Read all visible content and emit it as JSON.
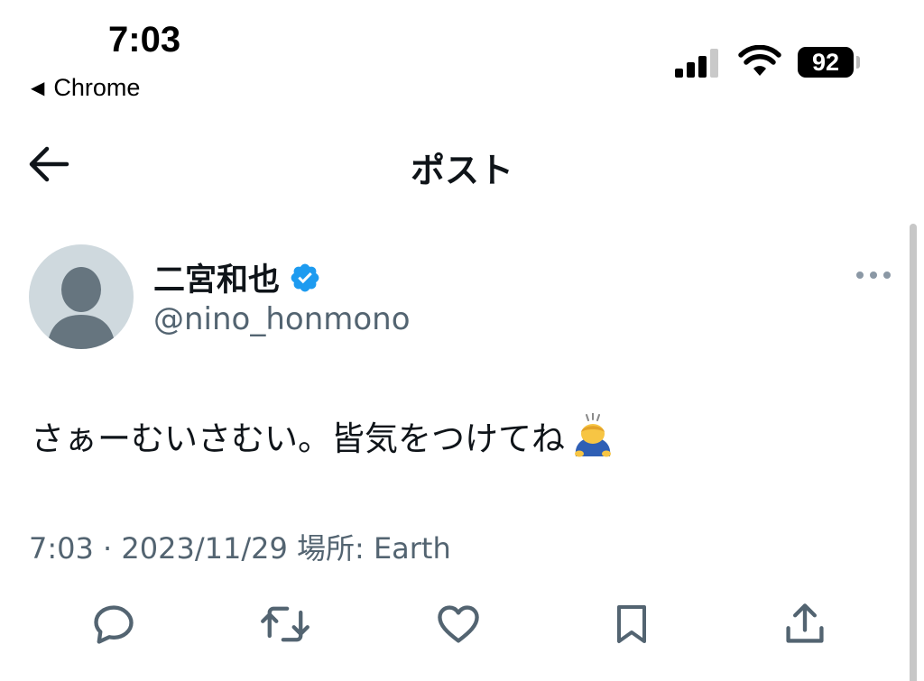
{
  "status_bar": {
    "time": "7:03",
    "back_app": "Chrome",
    "battery": "92"
  },
  "header": {
    "title": "ポスト"
  },
  "post": {
    "display_name": "二宮和也",
    "handle": "@nino_honmono",
    "text": "さぁーむいさむい。皆気をつけてね",
    "meta_time": "7:03",
    "meta_separator": "·",
    "meta_date": "2023/11/29",
    "meta_location": "場所: Earth"
  },
  "icons": {
    "back": "back-arrow-icon",
    "verified": "verified-badge-icon",
    "more": "more-options-icon",
    "reply": "reply-icon",
    "retweet": "retweet-icon",
    "like": "like-icon",
    "bookmark": "bookmark-icon",
    "share": "share-icon",
    "emoji": "person-bowing-emoji"
  },
  "colors": {
    "text": "#0f1419",
    "secondary": "#536471",
    "verified": "#1d9bf0",
    "avatar_bg": "#cfd9de",
    "avatar_fg": "#66757f"
  }
}
